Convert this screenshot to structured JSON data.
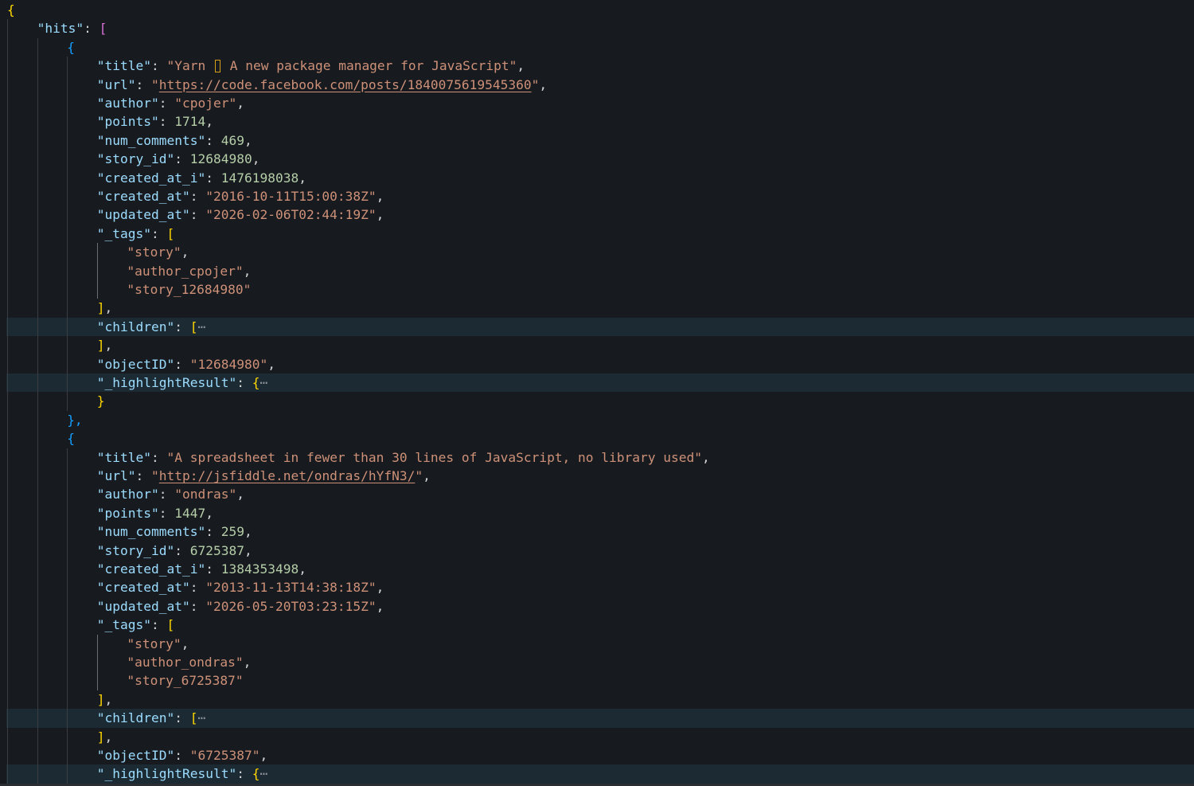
{
  "colors": {
    "background": "#171a1f",
    "key": "#9cdcfe",
    "string": "#ce9178",
    "number": "#b5cea8",
    "bracket_level_1": "#ffd700",
    "bracket_level_2": "#da70d6",
    "bracket_level_3": "#179fff",
    "folded_line_highlight": "#1c2b33"
  },
  "document": {
    "open_brace": "{",
    "hits_key": "\"hits\"",
    "hits": [
      {
        "open": "{",
        "title": "\"Yarn ",
        "title_rest": " A new package manager for JavaScript\"",
        "url": "https://code.facebook.com/posts/1840075619545360",
        "author": "\"cpojer\"",
        "points": "1714",
        "num_comments": "469",
        "story_id": "12684980",
        "created_at_i": "1476198038",
        "created_at": "\"2016-10-11T15:00:38Z\"",
        "updated_at": "\"2026-02-06T02:44:19Z\"",
        "tags": [
          "\"story\"",
          "\"author_cpojer\"",
          "\"story_12684980\""
        ],
        "objectID": "\"12684980\"",
        "close": "},"
      },
      {
        "open": "{",
        "title": "\"A spreadsheet in fewer than 30 lines of JavaScript, no library used\"",
        "url": "http://jsfiddle.net/ondras/hYfN3/",
        "author": "\"ondras\"",
        "points": "1447",
        "num_comments": "259",
        "story_id": "6725387",
        "created_at_i": "1384353498",
        "created_at": "\"2013-11-13T14:38:18Z\"",
        "updated_at": "\"2026-05-20T03:23:15Z\"",
        "tags": [
          "\"story\"",
          "\"author_ondras\"",
          "\"story_6725387\""
        ],
        "objectID": "\"6725387\""
      }
    ],
    "keys": {
      "title": "\"title\"",
      "url": "\"url\"",
      "author": "\"author\"",
      "points": "\"points\"",
      "num_comments": "\"num_comments\"",
      "story_id": "\"story_id\"",
      "created_at_i": "\"created_at_i\"",
      "created_at": "\"created_at\"",
      "updated_at": "\"updated_at\"",
      "tags": "\"_tags\"",
      "children": "\"children\"",
      "objectID": "\"objectID\"",
      "highlightResult": "\"_highlightResult\""
    },
    "fold_ellipsis": "⋯"
  }
}
